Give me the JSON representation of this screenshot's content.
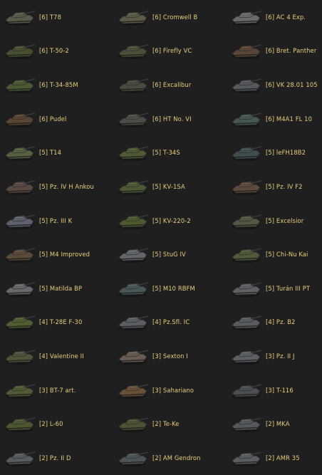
{
  "vehicles": [
    {
      "label": "[6] T78",
      "icon": "tank-icon",
      "color": "#5a5a4a"
    },
    {
      "label": "[6] Cromwell B",
      "icon": "tank-icon",
      "color": "#5c5a46"
    },
    {
      "label": "[6] AC 4 Exp.",
      "icon": "tank-icon",
      "color": "#6b6a6a"
    },
    {
      "label": "[6] T-50-2",
      "icon": "tank-icon",
      "color": "#46502f"
    },
    {
      "label": "[6] Firefly VC",
      "icon": "tank-icon",
      "color": "#4d4f38"
    },
    {
      "label": "[6] Bret. Panther",
      "icon": "tank-icon",
      "color": "#5a4536"
    },
    {
      "label": "[6] T-34-85M",
      "icon": "tank-icon",
      "color": "#4a5a32"
    },
    {
      "label": "[6] Excalibur",
      "icon": "tank-icon",
      "color": "#4a4a3e"
    },
    {
      "label": "[6] VK 28.01 105",
      "icon": "tank-icon",
      "color": "#55585c"
    },
    {
      "label": "[6] Pudel",
      "icon": "tank-icon",
      "color": "#5a4432"
    },
    {
      "label": "[6] HT No. VI",
      "icon": "tank-icon",
      "color": "#4a4e44"
    },
    {
      "label": "[6] M4A1 FL 10",
      "icon": "tank-icon",
      "color": "#455750"
    },
    {
      "label": "[5] T14",
      "icon": "tank-icon",
      "color": "#556040"
    },
    {
      "label": "[5] T-34S",
      "icon": "tank-icon",
      "color": "#4e5a34"
    },
    {
      "label": "[5] leFH18B2",
      "icon": "tank-icon",
      "color": "#3e4e50"
    },
    {
      "label": "[5] Pz. IV H Ankou",
      "icon": "tank-icon",
      "color": "#5c4842"
    },
    {
      "label": "[5] KV-1SA",
      "icon": "tank-icon",
      "color": "#4b5a34"
    },
    {
      "label": "[5] Pz. IV F2",
      "icon": "tank-icon",
      "color": "#5e4a3a"
    },
    {
      "label": "[5] Pz. III K",
      "icon": "tank-icon",
      "color": "#5e626e"
    },
    {
      "label": "[5] KV-220-2",
      "icon": "tank-icon",
      "color": "#4c5a30"
    },
    {
      "label": "[5] Excelsior",
      "icon": "tank-icon",
      "color": "#545742"
    },
    {
      "label": "[5] M4 Improved",
      "icon": "tank-icon",
      "color": "#5c4a38"
    },
    {
      "label": "[5] StuG IV",
      "icon": "tank-icon",
      "color": "#62666c"
    },
    {
      "label": "[5] Chi-Nu Kai",
      "icon": "tank-icon",
      "color": "#4e5a3a"
    },
    {
      "label": "[5] Matilda BP",
      "icon": "tank-icon",
      "color": "#66686a"
    },
    {
      "label": "[5] M10 RBFM",
      "icon": "tank-icon",
      "color": "#48585a"
    },
    {
      "label": "[5] Turán III PT",
      "icon": "tank-icon",
      "color": "#5e6064"
    },
    {
      "label": "[4] T-28E F-30",
      "icon": "tank-icon",
      "color": "#4e5e30"
    },
    {
      "label": "[4] Pz.Sfl. IC",
      "icon": "tank-icon",
      "color": "#5a5e64"
    },
    {
      "label": "[4] Pz. B2",
      "icon": "tank-icon",
      "color": "#585c60"
    },
    {
      "label": "[4] Valentine II",
      "icon": "tank-icon",
      "color": "#4e5436"
    },
    {
      "label": "[3] Sexton I",
      "icon": "tank-icon",
      "color": "#6a5a50"
    },
    {
      "label": "[3] Pz. II J",
      "icon": "tank-icon",
      "color": "#5c6066"
    },
    {
      "label": "[3] BT-7 art.",
      "icon": "tank-icon",
      "color": "#505a34"
    },
    {
      "label": "[3] Sahariano",
      "icon": "tank-icon",
      "color": "#6a5038"
    },
    {
      "label": "[3] T-116",
      "icon": "tank-icon",
      "color": "#4a4e52"
    },
    {
      "label": "[2] L-60",
      "icon": "tank-icon",
      "color": "#4c5630"
    },
    {
      "label": "[2] Te-Ke",
      "icon": "tank-icon",
      "color": "#4c5234"
    },
    {
      "label": "[2] MKA",
      "icon": "tank-icon",
      "color": "#55595e"
    },
    {
      "label": "[2] Pz. II D",
      "icon": "tank-icon",
      "color": "#585c60"
    },
    {
      "label": "[2] AM Gendron",
      "icon": "tank-icon",
      "color": "#4c5658"
    },
    {
      "label": "[2] AMR 35",
      "icon": "tank-icon",
      "color": "#5a5e62"
    }
  ],
  "label_color": "#e9cd7c",
  "background_color": "#1f1f1f"
}
